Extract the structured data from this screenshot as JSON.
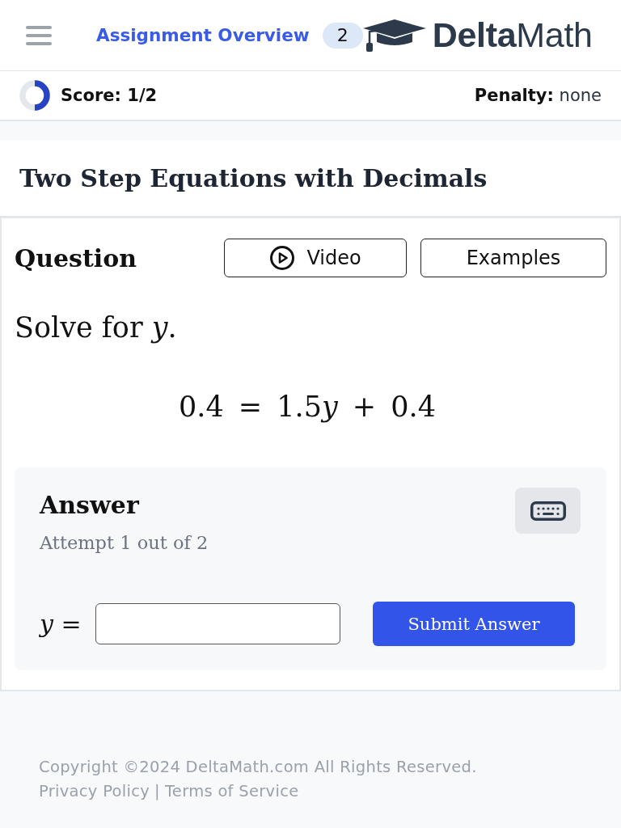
{
  "header": {
    "nav_link": "Assignment Overview",
    "badge": "2",
    "logo": "**Delta**Math"
  },
  "score_bar": {
    "score": {
      "label": "Score: 1/2",
      "level": 0.5
    },
    "penalty": "**Penalty:** none"
  },
  "assignment": {
    "title": "Two Step Equations with Decimals"
  },
  "question": {
    "heading": "Question",
    "buttons": [
      {
        "label": "Video",
        "kind": "video"
      },
      {
        "label": "Examples",
        "kind": "plain"
      }
    ],
    "prompt": "Solve for *y*.",
    "equation": [
      {
        "text": "0.4",
        "kind": "number"
      },
      {
        "text": "=",
        "kind": "operator"
      },
      {
        "text": "1.5",
        "kind": "number"
      },
      {
        "text": "y",
        "kind": "variable"
      },
      {
        "text": "+",
        "kind": "operator"
      },
      {
        "text": "0.4",
        "kind": "number"
      }
    ]
  },
  "answer": {
    "heading": "Answer",
    "attempt": "Attempt 1 out of 2",
    "variable": "*y* =",
    "submit": "Submit Answer"
  },
  "footer": {
    "copyright": "Copyright ©2024 DeltaMath.com All Rights Reserved.",
    "links": [
      "Privacy Policy",
      "Terms of Service"
    ],
    "separator": "|"
  }
}
